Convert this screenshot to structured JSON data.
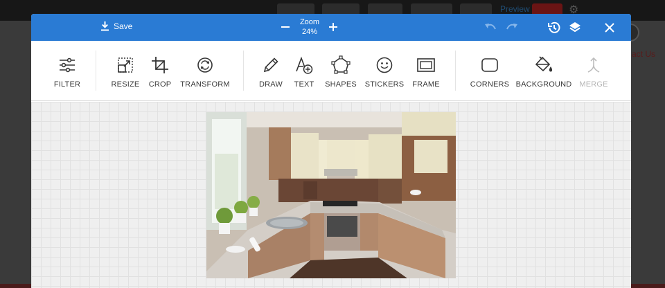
{
  "background": {
    "header_link": "Preview",
    "contact_text": "act Us"
  },
  "editor": {
    "save_label": "Save",
    "zoom": {
      "label": "Zoom",
      "value": "24%"
    },
    "tools": [
      {
        "label": "FILTER",
        "icon": "sliders-icon",
        "enabled": true
      },
      {
        "label": "RESIZE",
        "icon": "resize-icon",
        "enabled": true
      },
      {
        "label": "CROP",
        "icon": "crop-icon",
        "enabled": true
      },
      {
        "label": "TRANSFORM",
        "icon": "rotate-icon",
        "enabled": true
      },
      {
        "label": "DRAW",
        "icon": "pencil-icon",
        "enabled": true
      },
      {
        "label": "TEXT",
        "icon": "text-add-icon",
        "enabled": true
      },
      {
        "label": "SHAPES",
        "icon": "pentagon-icon",
        "enabled": true
      },
      {
        "label": "STICKERS",
        "icon": "smiley-icon",
        "enabled": true
      },
      {
        "label": "FRAME",
        "icon": "frame-icon",
        "enabled": true
      },
      {
        "label": "CORNERS",
        "icon": "rounded-square-icon",
        "enabled": true
      },
      {
        "label": "BACKGROUND",
        "icon": "paint-bucket-icon",
        "enabled": true
      },
      {
        "label": "MERGE",
        "icon": "merge-icon",
        "enabled": false
      }
    ],
    "colors": {
      "topbar": "#2a7bd4",
      "canvas": "#efefef"
    },
    "image_subject": "kitchen photo"
  }
}
